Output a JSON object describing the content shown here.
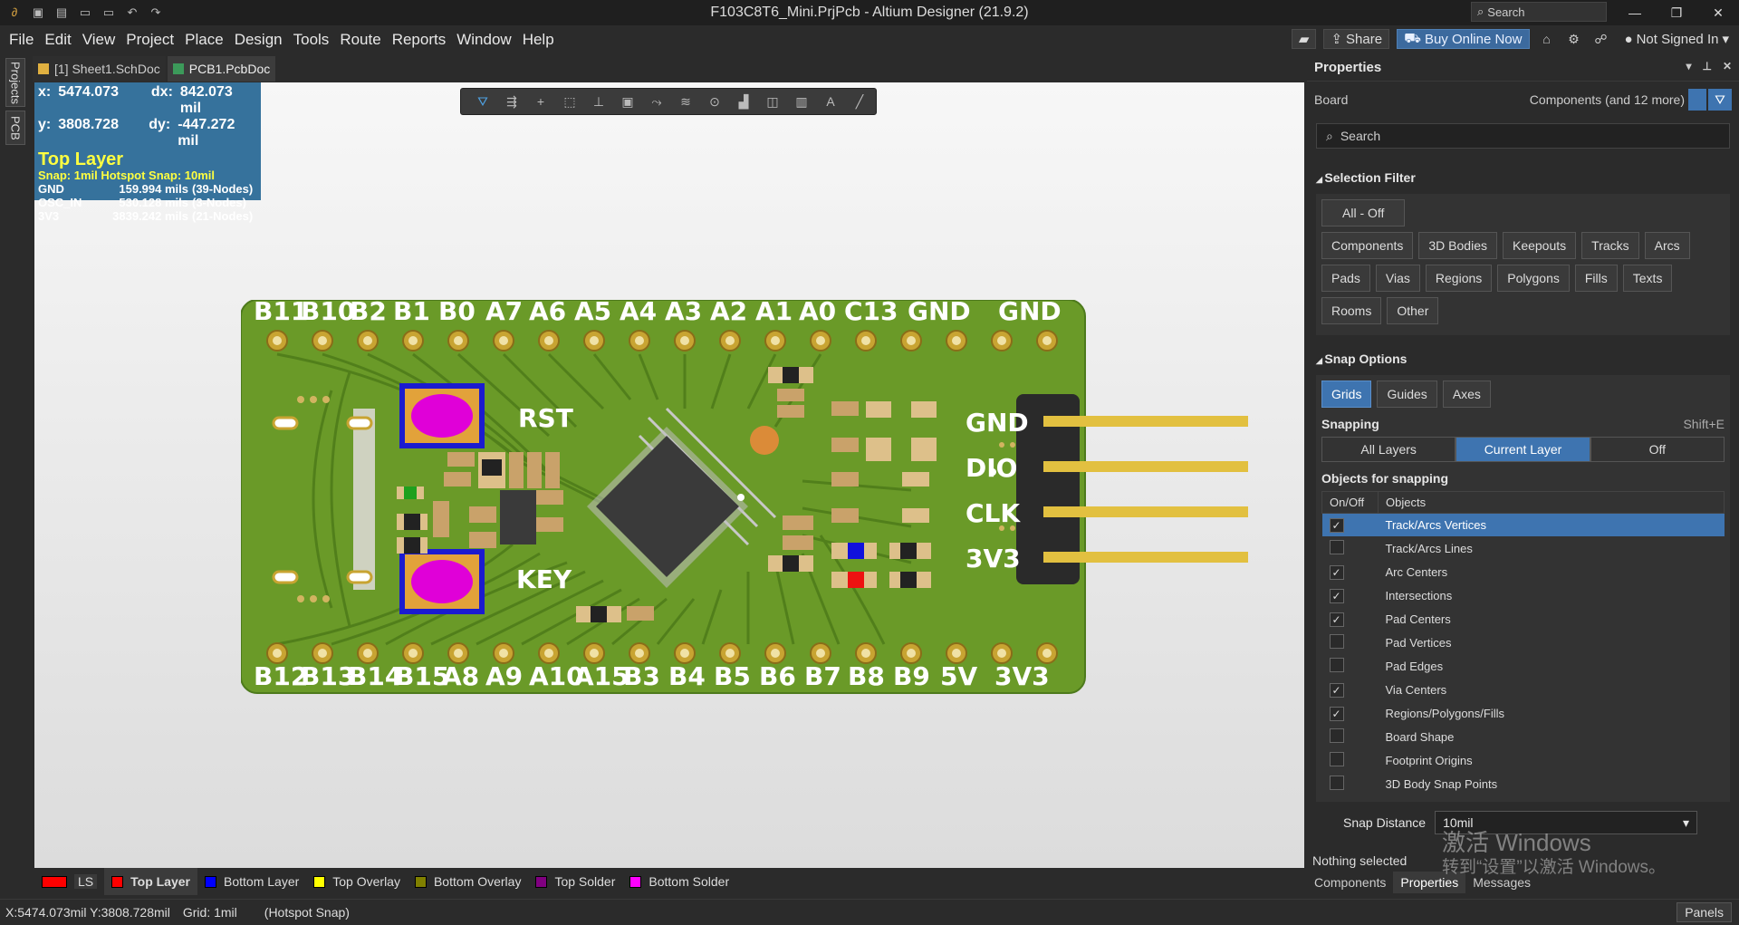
{
  "window": {
    "title": "F103C8T6_Mini.PrjPcb - Altium Designer (21.9.2)",
    "search_label": "Search"
  },
  "menu": [
    "File",
    "Edit",
    "View",
    "Project",
    "Place",
    "Design",
    "Tools",
    "Route",
    "Reports",
    "Window",
    "Help"
  ],
  "topbar": {
    "share": "Share",
    "buy": "Buy Online Now",
    "account": "Not Signed In"
  },
  "left_tabs": [
    "Projects",
    "PCB"
  ],
  "doc_tabs": [
    {
      "label": "[1] Sheet1.SchDoc",
      "active": false
    },
    {
      "label": "PCB1.PcbDoc",
      "active": true
    }
  ],
  "hud": {
    "x_label": "x:",
    "x": "5474.073",
    "dx_label": "dx:",
    "dx": "842.073 mil",
    "y_label": "y:",
    "y": "3808.728",
    "dy_label": "dy:",
    "dy": "-447.272 mil",
    "layer": "Top Layer",
    "snap": "Snap: 1mil Hotspot Snap: 10mil",
    "nets": [
      {
        "name": "GND",
        "length": "159.994 mils",
        "nodes": "(39-Nodes)"
      },
      {
        "name": "OSC_IN",
        "length": "530.128 mils",
        "nodes": "(3-Nodes)"
      },
      {
        "name": "3V3",
        "length": "3839.242 mils",
        "nodes": "(21-Nodes)"
      }
    ]
  },
  "pcb": {
    "top_labels": [
      "B11",
      "B10",
      "B2",
      "B1",
      "B0",
      "A7",
      "A6",
      "A5",
      "A4",
      "A3",
      "A2",
      "A1",
      "A0",
      "C13",
      "GND",
      "GND"
    ],
    "bottom_labels": [
      "B12",
      "B13",
      "B14",
      "B15",
      "A8",
      "A9",
      "A10",
      "A15",
      "B3",
      "B4",
      "B5",
      "B6",
      "B7",
      "B8",
      "B9",
      "5V",
      "3V3"
    ],
    "header_labels": [
      "GND",
      "DIO",
      "CLK",
      "3V3"
    ],
    "button_labels": [
      "RST",
      "KEY"
    ]
  },
  "layer_tabs": {
    "ls": "LS",
    "layers": [
      {
        "name": "Top Layer",
        "color": "#ff0000",
        "active": true
      },
      {
        "name": "Bottom Layer",
        "color": "#0000ff",
        "active": false
      },
      {
        "name": "Top Overlay",
        "color": "#ffff00",
        "active": false
      },
      {
        "name": "Bottom Overlay",
        "color": "#808000",
        "active": false
      },
      {
        "name": "Top Solder",
        "color": "#800080",
        "active": false
      },
      {
        "name": "Bottom Solder",
        "color": "#ff00ff",
        "active": false
      }
    ]
  },
  "status": {
    "coords": "X:5474.073mil Y:3808.728mil",
    "grid": "Grid: 1mil",
    "hotspot": "(Hotspot Snap)",
    "panels": "Panels"
  },
  "properties": {
    "title": "Properties",
    "board": "Board",
    "filter_summary": "Components (and 12 more)",
    "search_placeholder": "Search",
    "selection_filter": {
      "title": "Selection Filter",
      "all_off": "All - Off",
      "buttons_row1": [
        "Components",
        "3D Bodies",
        "Keepouts",
        "Tracks",
        "Arcs"
      ],
      "buttons_row2": [
        "Pads",
        "Vias",
        "Regions",
        "Polygons",
        "Fills",
        "Texts"
      ],
      "buttons_row3": [
        "Rooms",
        "Other"
      ]
    },
    "snap_options": {
      "title": "Snap Options",
      "grid_buttons": [
        {
          "label": "Grids",
          "on": true
        },
        {
          "label": "Guides",
          "on": false
        },
        {
          "label": "Axes",
          "on": false
        }
      ],
      "snapping_label": "Snapping",
      "snapping_shortcut": "Shift+E",
      "snapping_modes": [
        {
          "label": "All Layers",
          "on": false
        },
        {
          "label": "Current Layer",
          "on": true
        },
        {
          "label": "Off",
          "on": false
        }
      ],
      "objects_label": "Objects for snapping",
      "col_onoff": "On/Off",
      "col_objects": "Objects",
      "objects": [
        {
          "name": "Track/Arcs Vertices",
          "checked": true,
          "selected": true
        },
        {
          "name": "Track/Arcs Lines",
          "checked": false,
          "selected": false
        },
        {
          "name": "Arc Centers",
          "checked": true,
          "selected": false
        },
        {
          "name": "Intersections",
          "checked": true,
          "selected": false
        },
        {
          "name": "Pad Centers",
          "checked": true,
          "selected": false
        },
        {
          "name": "Pad Vertices",
          "checked": false,
          "selected": false
        },
        {
          "name": "Pad Edges",
          "checked": false,
          "selected": false
        },
        {
          "name": "Via Centers",
          "checked": true,
          "selected": false
        },
        {
          "name": "Regions/Polygons/Fills",
          "checked": true,
          "selected": false
        },
        {
          "name": "Board Shape",
          "checked": false,
          "selected": false
        },
        {
          "name": "Footprint Origins",
          "checked": false,
          "selected": false
        },
        {
          "name": "3D Body Snap Points",
          "checked": false,
          "selected": false
        }
      ],
      "snap_distance_label": "Snap Distance",
      "snap_distance": "10mil"
    },
    "nothing_selected": "Nothing selected",
    "footer_tabs": [
      {
        "label": "Components",
        "on": false
      },
      {
        "label": "Properties",
        "on": true
      },
      {
        "label": "Messages",
        "on": false
      }
    ]
  },
  "watermark": {
    "line1": "激活 Windows",
    "line2": "转到“设置”以激活 Windows。"
  }
}
